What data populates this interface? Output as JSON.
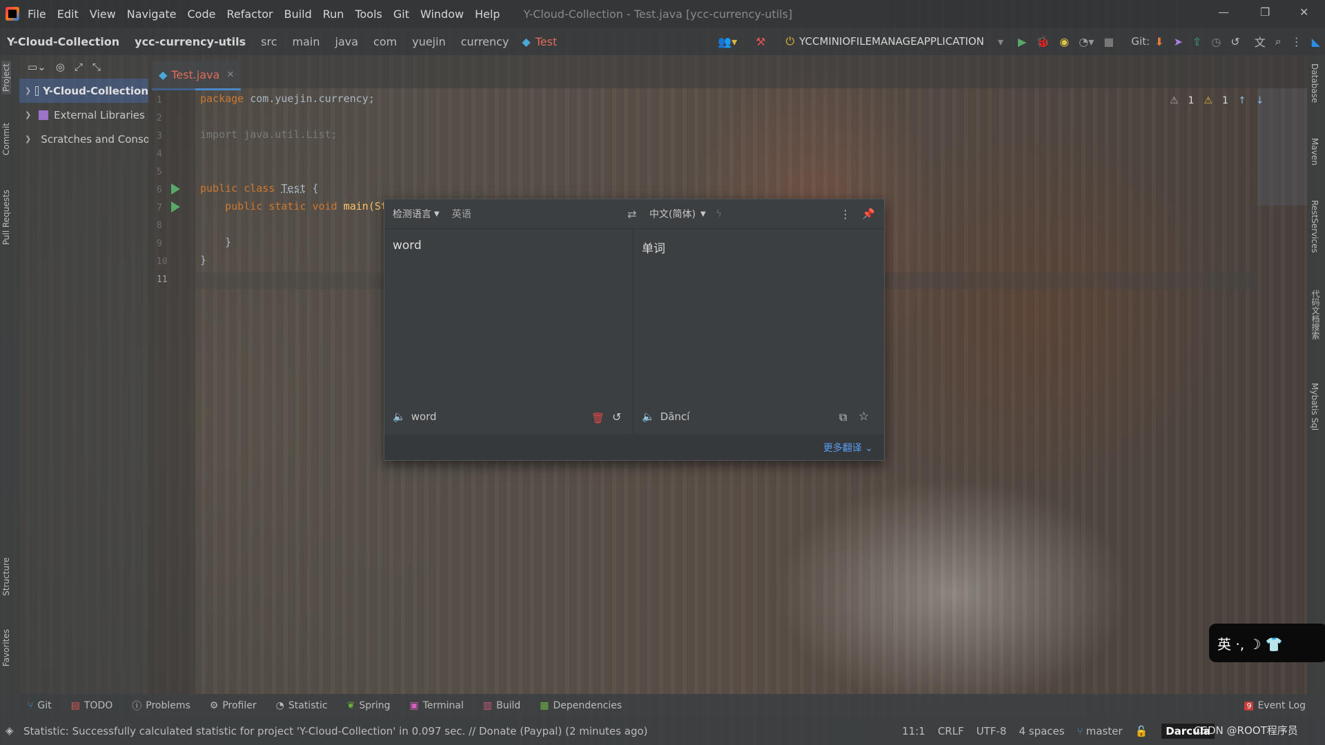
{
  "menu": {
    "items": [
      "File",
      "Edit",
      "View",
      "Navigate",
      "Code",
      "Refactor",
      "Build",
      "Run",
      "Tools",
      "Git",
      "Window",
      "Help"
    ],
    "window_title": "Y-Cloud-Collection - Test.java [ycc-currency-utils]"
  },
  "nav": {
    "crumbs": [
      "Y-Cloud-Collection",
      "ycc-currency-utils",
      "src",
      "main",
      "java",
      "com",
      "yuejin",
      "currency",
      "Test"
    ],
    "run_config": "YCCMINIOFILEMANAGEAPPLICATION",
    "git_label": "Git:"
  },
  "left_stripe": {
    "project": "Project",
    "commit": "Commit",
    "pull_requests": "Pull Requests",
    "structure": "Structure",
    "favorites": "Favorites"
  },
  "right_stripe": {
    "database": "Database",
    "maven": "Maven",
    "rest": "RestServices",
    "search": "代码文档搜索",
    "mybatis": "Mybatis Sql"
  },
  "project_tree": [
    {
      "label": "Y-Cloud-Collection"
    },
    {
      "label": "External Libraries"
    },
    {
      "label": "Scratches and Consoles"
    }
  ],
  "editor": {
    "tab_label": "Test.java",
    "lines": [
      "1",
      "2",
      "3",
      "4",
      "5",
      "6",
      "7",
      "8",
      "9",
      "10",
      "11"
    ],
    "code": {
      "pkg_kw": "package",
      "pkg_name": " com.yuejin.currency;",
      "import": "import java.util.List;",
      "cls_kw": "public class ",
      "cls_name": "Test",
      "cls_brace": " {",
      "main_kw": "    public static void ",
      "main_name": "main(St",
      "close_inner": "    }",
      "close_outer": "}"
    },
    "inspections": {
      "weak": "1",
      "warn": "1"
    }
  },
  "translator": {
    "source_lang_label": "检测语言",
    "detected": "英语",
    "target_lang": "中文(简体)",
    "source_text": "word",
    "target_text": "单词",
    "source_phonetic": "word",
    "target_phonetic": "Dāncí",
    "more": "更多翻译"
  },
  "toolwindows": [
    "Git",
    "TODO",
    "Problems",
    "Profiler",
    "Statistic",
    "Spring",
    "Terminal",
    "Build",
    "Dependencies"
  ],
  "event_log": {
    "count": "9",
    "label": "Event Log"
  },
  "status": {
    "message": "Statistic: Successfully calculated statistic for project 'Y-Cloud-Collection' in 0.097 sec. // Donate (Paypal) (2 minutes ago)",
    "position": "11:1",
    "line_sep": "CRLF",
    "encoding": "UTF-8",
    "indent": "4 spaces",
    "branch": "master",
    "theme": "Darcula"
  },
  "ime": {
    "text": "英 ·, ☽ 👕"
  },
  "watermark": "CSDN @ROOT程序员",
  "colors": {
    "accent": "#4a88c7",
    "run_green": "#59a869",
    "keyword": "#cc7832",
    "link": "#589df6"
  }
}
